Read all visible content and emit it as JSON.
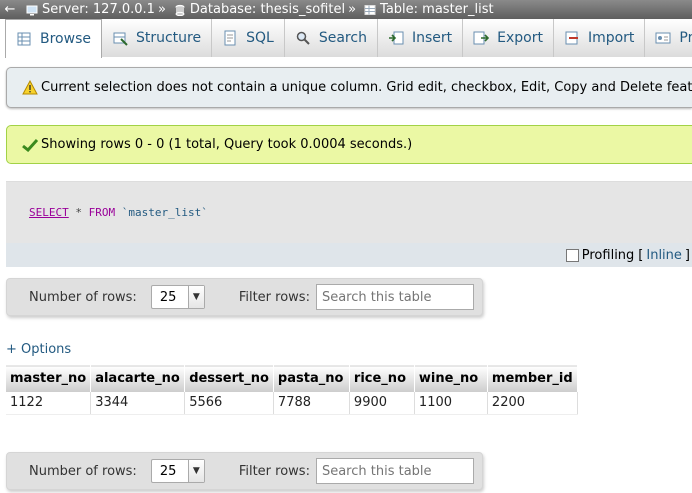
{
  "breadcrumb": {
    "back_glyph": "←",
    "server": "Server: 127.0.0.1",
    "database": "Database: thesis_sofitel",
    "table": "Table: master_list",
    "separator": "»"
  },
  "tabs": [
    {
      "label": "Browse",
      "icon": "browse-icon"
    },
    {
      "label": "Structure",
      "icon": "structure-icon"
    },
    {
      "label": "SQL",
      "icon": "sql-icon"
    },
    {
      "label": "Search",
      "icon": "search-icon"
    },
    {
      "label": "Insert",
      "icon": "insert-icon"
    },
    {
      "label": "Export",
      "icon": "export-icon"
    },
    {
      "label": "Import",
      "icon": "import-icon"
    },
    {
      "label": "Priv",
      "icon": "privileges-icon"
    }
  ],
  "notice": "Current selection does not contain a unique column. Grid edit, checkbox, Edit, Copy and Delete features are not",
  "success": "Showing rows 0 - 0 (1 total, Query took 0.0004 seconds.)",
  "sql": {
    "select": "SELECT",
    "star": "*",
    "from": "FROM",
    "table": "`master_list`"
  },
  "profiling": {
    "label": "Profiling",
    "open_bracket": "[",
    "inline": "Inline",
    "close_bracket": "]"
  },
  "nav": {
    "rows_label": "Number of rows:",
    "rows_value": "25",
    "filter_label": "Filter rows:",
    "filter_placeholder": "Search this table"
  },
  "options_label": "+ Options",
  "table": {
    "columns": [
      "master_no",
      "alacarte_no",
      "dessert_no",
      "pasta_no",
      "rice_no",
      "wine_no",
      "member_id"
    ],
    "rows": [
      [
        "1122",
        "3344",
        "5566",
        "7788",
        "9900",
        "1100",
        "2200"
      ]
    ]
  },
  "colors": {
    "link": "#235a81",
    "success_bg": "#ebf8a4",
    "notice_bg": "#e8eef1",
    "sql_keyword": "#990099"
  }
}
